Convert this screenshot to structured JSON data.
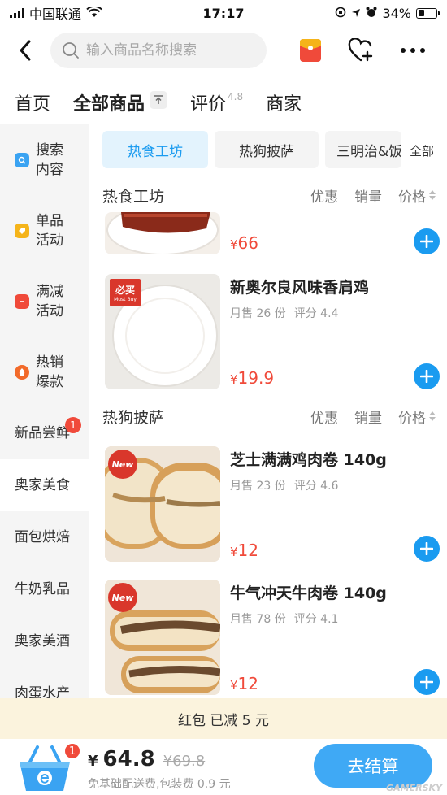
{
  "status": {
    "carrier": "中国联通",
    "time": "17:17",
    "battery": "34%",
    "battery_level": 0.34,
    "icons": [
      "wifi-icon",
      "orientation-lock-icon",
      "location-icon",
      "alarm-icon"
    ]
  },
  "topbar": {
    "search_placeholder": "输入商品名称搜索",
    "icons": [
      "back-icon",
      "search-icon",
      "red-packet-icon",
      "favorite-add-icon",
      "more-icon"
    ]
  },
  "tabs": [
    {
      "label": "首页"
    },
    {
      "label": "全部商品",
      "active": true
    },
    {
      "label": "评价",
      "sup": "4.8"
    },
    {
      "label": "商家"
    }
  ],
  "sidebar": {
    "items": [
      {
        "label": "搜索内容",
        "icon": "search-icon",
        "color": "#3aa3f2"
      },
      {
        "label": "单品活动",
        "icon": "tag-icon",
        "color": "#f5b41a"
      },
      {
        "label": "满减活动",
        "icon": "discount-icon",
        "color": "#f04a3a"
      },
      {
        "label": "热销爆款",
        "icon": "fire-icon",
        "color": "#f26a2a"
      },
      {
        "label": "新品尝鲜",
        "badge": "1"
      },
      {
        "label": "奥家美食",
        "active": true
      },
      {
        "label": "面包烘焙"
      },
      {
        "label": "牛奶乳品"
      },
      {
        "label": "奥家美酒"
      },
      {
        "label": "肉蛋水产"
      }
    ]
  },
  "chips": {
    "items": [
      "热食工坊",
      "热狗披萨",
      "三明治&饭"
    ],
    "all_label": "全部"
  },
  "sections": [
    {
      "title": "热食工坊",
      "sort": [
        "优惠",
        "销量",
        "价格"
      ],
      "products": [
        {
          "price": "66",
          "price_symbol": "¥"
        },
        {
          "name": "新奥尔良风味香肩鸡",
          "sales": "月售 26 份",
          "rating": "评分 4.4",
          "price": "19.9",
          "price_symbol": "¥",
          "tag": "必买",
          "tag_sub": "Must Buy"
        }
      ]
    },
    {
      "title": "热狗披萨",
      "sort": [
        "优惠",
        "销量",
        "价格"
      ],
      "products": [
        {
          "name": "芝士满满鸡肉卷 140g",
          "sales": "月售 23 份",
          "rating": "评分 4.6",
          "price": "12",
          "price_symbol": "¥",
          "tag": "New"
        },
        {
          "name": "牛气冲天牛肉卷 140g",
          "sales": "月售 78 份",
          "rating": "评分 4.1",
          "price": "12",
          "price_symbol": "¥",
          "tag": "New"
        }
      ]
    }
  ],
  "promo": {
    "text": "红包 已减 5 元"
  },
  "bottom": {
    "cart_count": "1",
    "currency": "¥",
    "total": "64.8",
    "original": "¥69.8",
    "fee": "免基础配送费,包装费 0.9 元",
    "checkout_label": "去结算",
    "watermark": "GAMERSKY"
  },
  "colors": {
    "accent": "#1a9bf0",
    "price": "#f04a3a",
    "promo_bg": "#fbf3dd"
  }
}
